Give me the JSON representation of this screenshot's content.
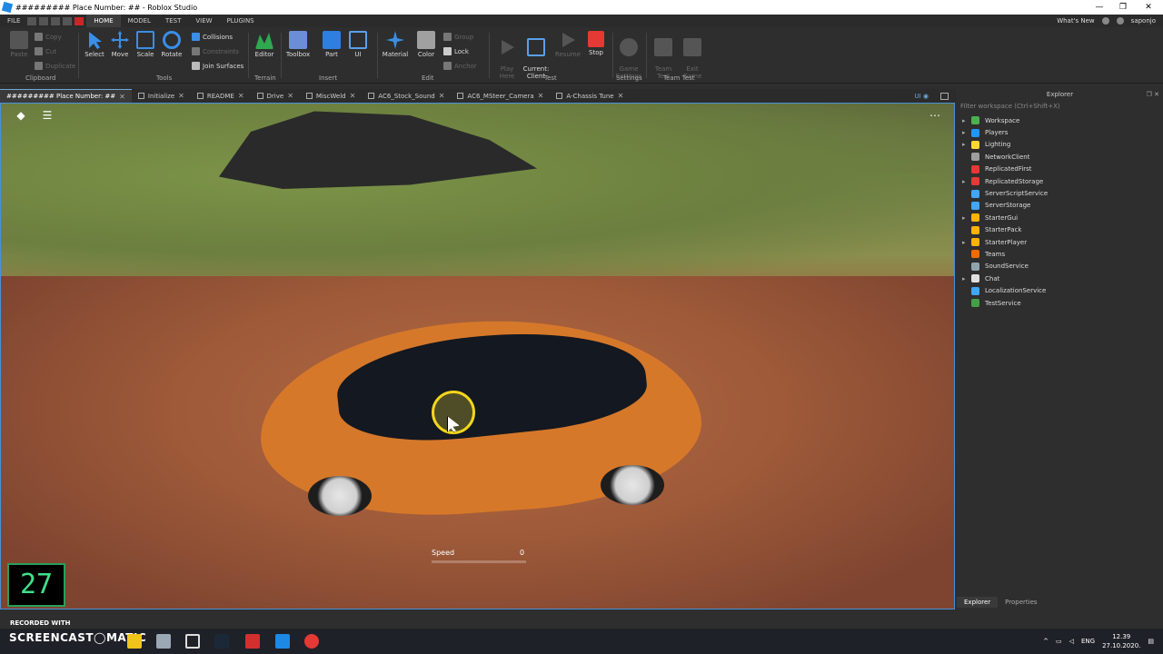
{
  "window": {
    "title": "######### Place Number: ## - Roblox Studio",
    "controls": [
      "—",
      "❐",
      "✕"
    ]
  },
  "menubar": {
    "items": [
      "FILE",
      "HOME",
      "MODEL",
      "TEST",
      "VIEW",
      "PLUGINS"
    ],
    "active": "HOME",
    "whats_new": "What's New",
    "user": "saponjo"
  },
  "ribbon": {
    "clipboard": {
      "paste": "Paste",
      "copy": "Copy",
      "cut": "Cut",
      "duplicate": "Duplicate",
      "label": "Clipboard"
    },
    "tools": {
      "select": "Select",
      "move": "Move",
      "scale": "Scale",
      "rotate": "Rotate",
      "collisions": "Collisions",
      "constraints": "Constraints",
      "join_surfaces": "Join Surfaces",
      "label": "Tools"
    },
    "terrain": {
      "editor": "Editor",
      "label": "Terrain"
    },
    "insert": {
      "toolbox": "Toolbox",
      "part": "Part",
      "ui": "UI",
      "label": "Insert"
    },
    "edit": {
      "material": "Material",
      "color": "Color",
      "group": "Group",
      "lock": "Lock",
      "anchor": "Anchor",
      "label": "Edit"
    },
    "test": {
      "play_here": "Play\nHere",
      "current_client": "Current:\nClient",
      "resume": "Resume",
      "stop": "Stop",
      "label": "Test"
    },
    "settings": {
      "game_settings": "Game\nSettings",
      "label": "Settings"
    },
    "team_test": {
      "team_test": "Team\nTest",
      "exit_game": "Exit\nGame",
      "label": "Team Test"
    }
  },
  "tabs": [
    {
      "label": "######### Place Number: ##"
    },
    {
      "label": "Initialize"
    },
    {
      "label": "README"
    },
    {
      "label": "Drive"
    },
    {
      "label": "MiscWeld"
    },
    {
      "label": "AC6_Stock_Sound"
    },
    {
      "label": "AC6_MSteer_Camera"
    },
    {
      "label": "A-Chassis Tune"
    }
  ],
  "ui_toggle": "UI",
  "viewport": {
    "speed_label": "Speed",
    "speed_value": "0",
    "timer": "27 S"
  },
  "explorer": {
    "title": "Explorer",
    "filter_placeholder": "Filter workspace (Ctrl+Shift+X)",
    "items": [
      {
        "label": "Workspace",
        "expandable": true,
        "color": "#4caf50"
      },
      {
        "label": "Players",
        "expandable": true,
        "color": "#2196f3"
      },
      {
        "label": "Lighting",
        "expandable": true,
        "color": "#fdd835"
      },
      {
        "label": "NetworkClient",
        "expandable": false,
        "color": "#9e9e9e"
      },
      {
        "label": "ReplicatedFirst",
        "expandable": false,
        "color": "#e53935"
      },
      {
        "label": "ReplicatedStorage",
        "expandable": true,
        "color": "#e53935"
      },
      {
        "label": "ServerScriptService",
        "expandable": false,
        "color": "#42a5f5"
      },
      {
        "label": "ServerStorage",
        "expandable": false,
        "color": "#42a5f5"
      },
      {
        "label": "StarterGui",
        "expandable": true,
        "color": "#ffb300"
      },
      {
        "label": "StarterPack",
        "expandable": false,
        "color": "#ffb300"
      },
      {
        "label": "StarterPlayer",
        "expandable": true,
        "color": "#ffb300"
      },
      {
        "label": "Teams",
        "expandable": false,
        "color": "#ef6c00"
      },
      {
        "label": "SoundService",
        "expandable": false,
        "color": "#90a4ae"
      },
      {
        "label": "Chat",
        "expandable": true,
        "color": "#e0e0e0"
      },
      {
        "label": "LocalizationService",
        "expandable": false,
        "color": "#42a5f5"
      },
      {
        "label": "TestService",
        "expandable": false,
        "color": "#43a047"
      }
    ],
    "bottom_tabs": [
      "Explorer",
      "Properties"
    ]
  },
  "recorder": {
    "recorded_with": "RECORDED WITH",
    "brand": "SCREENCAST◯MATIC"
  },
  "taskbar": {
    "language": "ENG",
    "time": "12.39",
    "date": "27.10.2020."
  }
}
